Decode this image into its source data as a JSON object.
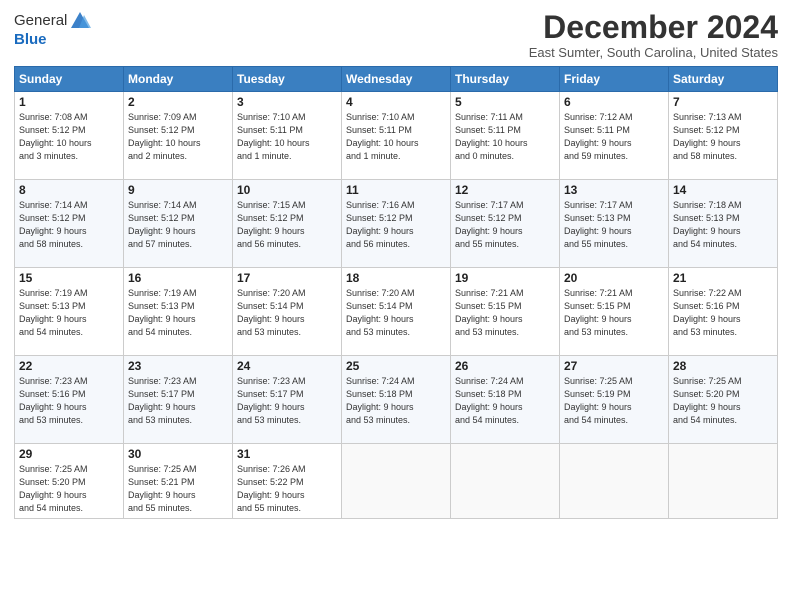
{
  "header": {
    "logo_general": "General",
    "logo_blue": "Blue",
    "month": "December 2024",
    "location": "East Sumter, South Carolina, United States"
  },
  "weekdays": [
    "Sunday",
    "Monday",
    "Tuesday",
    "Wednesday",
    "Thursday",
    "Friday",
    "Saturday"
  ],
  "weeks": [
    [
      {
        "day": "1",
        "info": "Sunrise: 7:08 AM\nSunset: 5:12 PM\nDaylight: 10 hours\nand 3 minutes."
      },
      {
        "day": "2",
        "info": "Sunrise: 7:09 AM\nSunset: 5:12 PM\nDaylight: 10 hours\nand 2 minutes."
      },
      {
        "day": "3",
        "info": "Sunrise: 7:10 AM\nSunset: 5:11 PM\nDaylight: 10 hours\nand 1 minute."
      },
      {
        "day": "4",
        "info": "Sunrise: 7:10 AM\nSunset: 5:11 PM\nDaylight: 10 hours\nand 1 minute."
      },
      {
        "day": "5",
        "info": "Sunrise: 7:11 AM\nSunset: 5:11 PM\nDaylight: 10 hours\nand 0 minutes."
      },
      {
        "day": "6",
        "info": "Sunrise: 7:12 AM\nSunset: 5:11 PM\nDaylight: 9 hours\nand 59 minutes."
      },
      {
        "day": "7",
        "info": "Sunrise: 7:13 AM\nSunset: 5:12 PM\nDaylight: 9 hours\nand 58 minutes."
      }
    ],
    [
      {
        "day": "8",
        "info": "Sunrise: 7:14 AM\nSunset: 5:12 PM\nDaylight: 9 hours\nand 58 minutes."
      },
      {
        "day": "9",
        "info": "Sunrise: 7:14 AM\nSunset: 5:12 PM\nDaylight: 9 hours\nand 57 minutes."
      },
      {
        "day": "10",
        "info": "Sunrise: 7:15 AM\nSunset: 5:12 PM\nDaylight: 9 hours\nand 56 minutes."
      },
      {
        "day": "11",
        "info": "Sunrise: 7:16 AM\nSunset: 5:12 PM\nDaylight: 9 hours\nand 56 minutes."
      },
      {
        "day": "12",
        "info": "Sunrise: 7:17 AM\nSunset: 5:12 PM\nDaylight: 9 hours\nand 55 minutes."
      },
      {
        "day": "13",
        "info": "Sunrise: 7:17 AM\nSunset: 5:13 PM\nDaylight: 9 hours\nand 55 minutes."
      },
      {
        "day": "14",
        "info": "Sunrise: 7:18 AM\nSunset: 5:13 PM\nDaylight: 9 hours\nand 54 minutes."
      }
    ],
    [
      {
        "day": "15",
        "info": "Sunrise: 7:19 AM\nSunset: 5:13 PM\nDaylight: 9 hours\nand 54 minutes."
      },
      {
        "day": "16",
        "info": "Sunrise: 7:19 AM\nSunset: 5:13 PM\nDaylight: 9 hours\nand 54 minutes."
      },
      {
        "day": "17",
        "info": "Sunrise: 7:20 AM\nSunset: 5:14 PM\nDaylight: 9 hours\nand 53 minutes."
      },
      {
        "day": "18",
        "info": "Sunrise: 7:20 AM\nSunset: 5:14 PM\nDaylight: 9 hours\nand 53 minutes."
      },
      {
        "day": "19",
        "info": "Sunrise: 7:21 AM\nSunset: 5:15 PM\nDaylight: 9 hours\nand 53 minutes."
      },
      {
        "day": "20",
        "info": "Sunrise: 7:21 AM\nSunset: 5:15 PM\nDaylight: 9 hours\nand 53 minutes."
      },
      {
        "day": "21",
        "info": "Sunrise: 7:22 AM\nSunset: 5:16 PM\nDaylight: 9 hours\nand 53 minutes."
      }
    ],
    [
      {
        "day": "22",
        "info": "Sunrise: 7:23 AM\nSunset: 5:16 PM\nDaylight: 9 hours\nand 53 minutes."
      },
      {
        "day": "23",
        "info": "Sunrise: 7:23 AM\nSunset: 5:17 PM\nDaylight: 9 hours\nand 53 minutes."
      },
      {
        "day": "24",
        "info": "Sunrise: 7:23 AM\nSunset: 5:17 PM\nDaylight: 9 hours\nand 53 minutes."
      },
      {
        "day": "25",
        "info": "Sunrise: 7:24 AM\nSunset: 5:18 PM\nDaylight: 9 hours\nand 53 minutes."
      },
      {
        "day": "26",
        "info": "Sunrise: 7:24 AM\nSunset: 5:18 PM\nDaylight: 9 hours\nand 54 minutes."
      },
      {
        "day": "27",
        "info": "Sunrise: 7:25 AM\nSunset: 5:19 PM\nDaylight: 9 hours\nand 54 minutes."
      },
      {
        "day": "28",
        "info": "Sunrise: 7:25 AM\nSunset: 5:20 PM\nDaylight: 9 hours\nand 54 minutes."
      }
    ],
    [
      {
        "day": "29",
        "info": "Sunrise: 7:25 AM\nSunset: 5:20 PM\nDaylight: 9 hours\nand 54 minutes."
      },
      {
        "day": "30",
        "info": "Sunrise: 7:25 AM\nSunset: 5:21 PM\nDaylight: 9 hours\nand 55 minutes."
      },
      {
        "day": "31",
        "info": "Sunrise: 7:26 AM\nSunset: 5:22 PM\nDaylight: 9 hours\nand 55 minutes."
      },
      null,
      null,
      null,
      null
    ]
  ]
}
